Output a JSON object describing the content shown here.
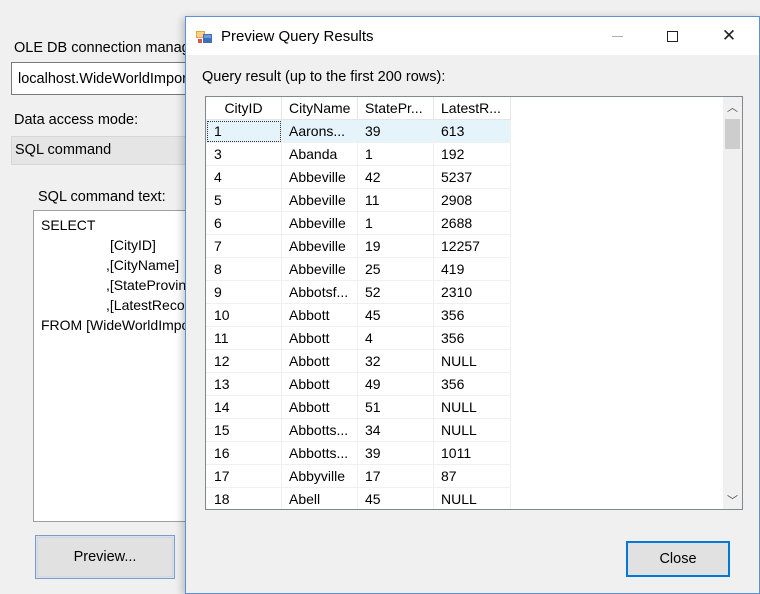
{
  "editor": {
    "connection_label": "OLE DB connection manager:",
    "connection_value": "localhost.WideWorldImporters",
    "access_mode_label": "Data access mode:",
    "access_mode_value": "SQL command",
    "sql_label": "SQL command text:",
    "sql_lines": [
      "SELECT",
      "[CityID]",
      ",[CityName]",
      ",[StateProvinceID]",
      ",[LatestRecordedPopulation]",
      "FROM [WideWorldImporters]"
    ],
    "preview_label": "Preview..."
  },
  "dialog": {
    "title": "Preview Query Results",
    "close_glyph": "✕",
    "result_label": "Query result (up to the first 200 rows):",
    "close_button": "Close",
    "columns": [
      "CityID",
      "CityName",
      "StatePr...",
      "LatestR..."
    ],
    "rows": [
      [
        "1",
        "Aarons...",
        "39",
        "613"
      ],
      [
        "3",
        "Abanda",
        "1",
        "192"
      ],
      [
        "4",
        "Abbeville",
        "42",
        "5237"
      ],
      [
        "5",
        "Abbeville",
        "11",
        "2908"
      ],
      [
        "6",
        "Abbeville",
        "1",
        "2688"
      ],
      [
        "7",
        "Abbeville",
        "19",
        "12257"
      ],
      [
        "8",
        "Abbeville",
        "25",
        "419"
      ],
      [
        "9",
        "Abbotsf...",
        "52",
        "2310"
      ],
      [
        "10",
        "Abbott",
        "45",
        "356"
      ],
      [
        "11",
        "Abbott",
        "4",
        "356"
      ],
      [
        "12",
        "Abbott",
        "32",
        "NULL"
      ],
      [
        "13",
        "Abbott",
        "49",
        "356"
      ],
      [
        "14",
        "Abbott",
        "51",
        "NULL"
      ],
      [
        "15",
        "Abbotts...",
        "34",
        "NULL"
      ],
      [
        "16",
        "Abbotts...",
        "39",
        "1011"
      ],
      [
        "17",
        "Abbyville",
        "17",
        "87"
      ],
      [
        "18",
        "Abell",
        "45",
        "NULL"
      ]
    ],
    "scroll_up_glyph": "︿",
    "scroll_down_glyph": "﹀"
  }
}
